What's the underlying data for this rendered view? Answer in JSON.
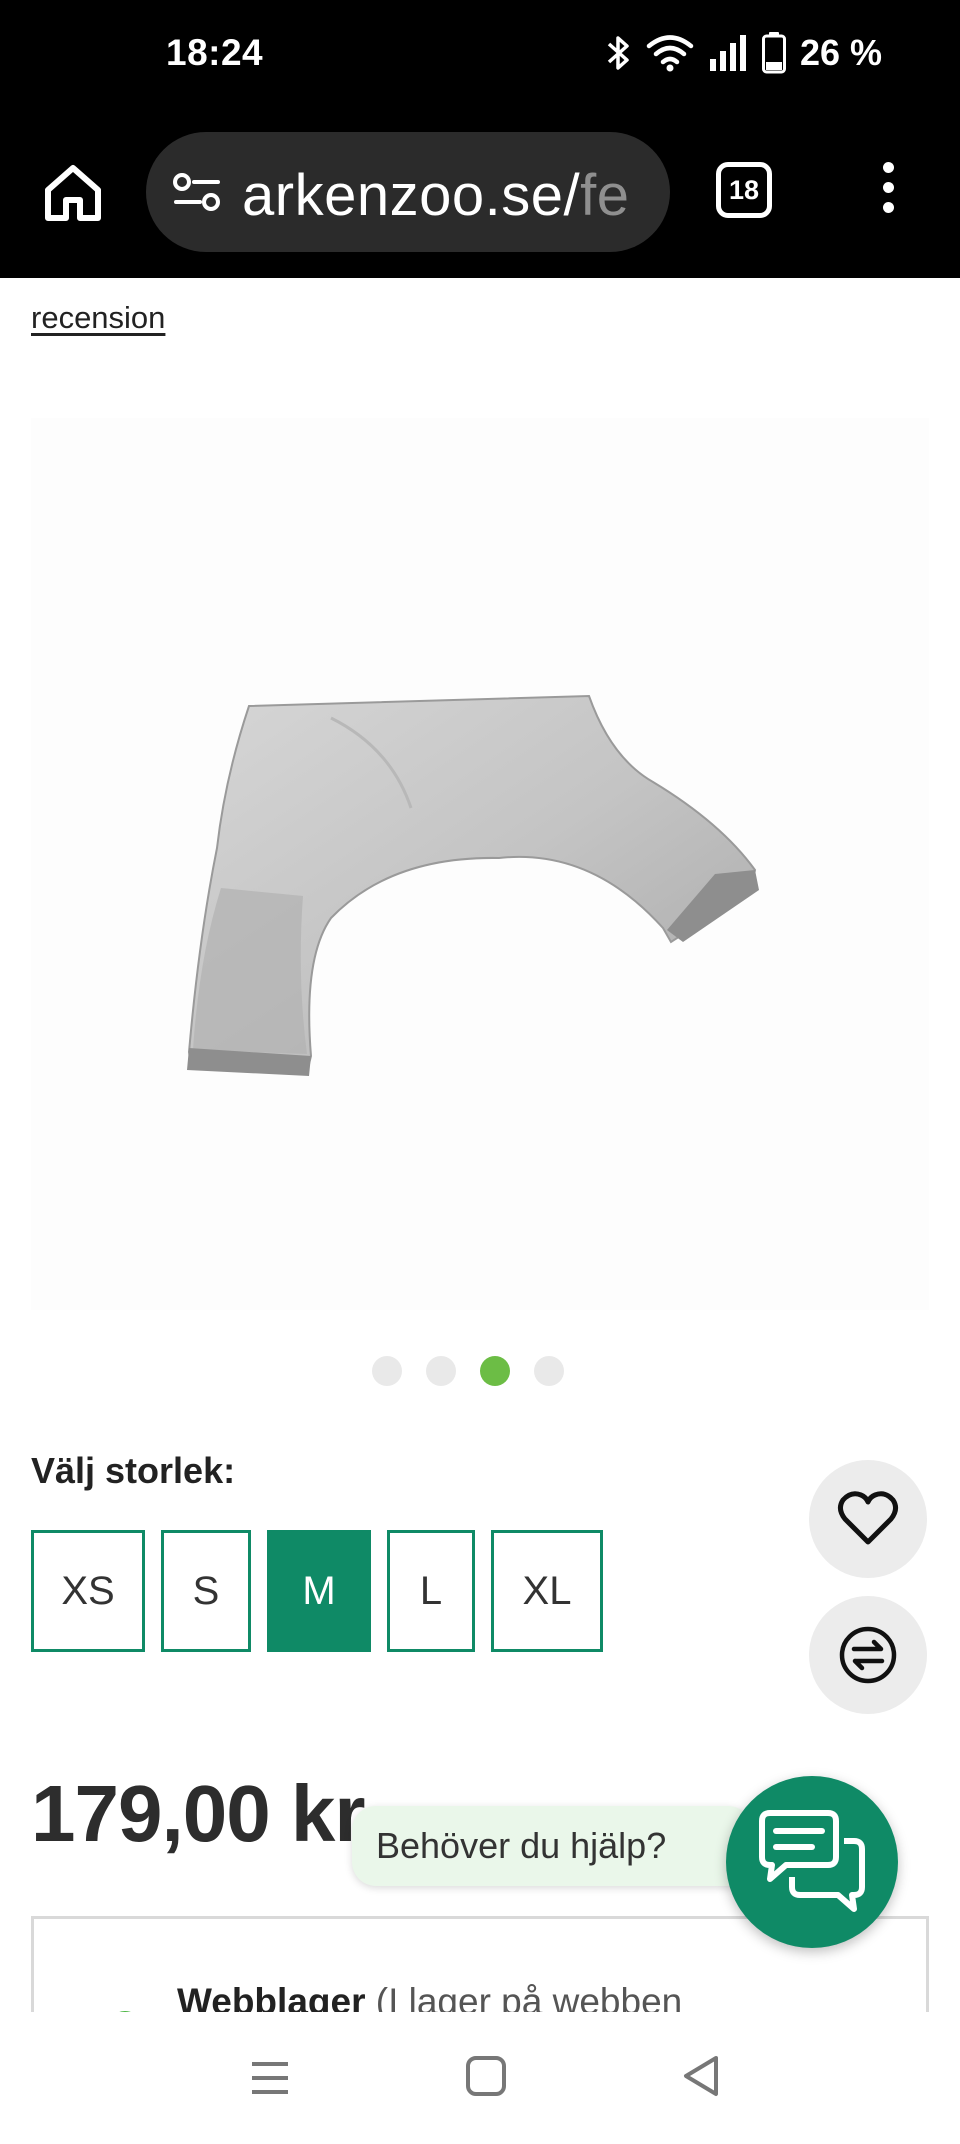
{
  "status_bar": {
    "time": "18:24",
    "battery": "26 %",
    "icons": [
      "bluetooth-icon",
      "wifi-icon",
      "signal-icon",
      "battery-icon"
    ]
  },
  "browser": {
    "url_main": "arkenzoo.se/",
    "url_faded": "fe",
    "tab_count": "18"
  },
  "product": {
    "review_link": "recension",
    "gallery": {
      "total_images": 4,
      "active_index": 2
    },
    "size_label": "Välj storlek:",
    "sizes": [
      "XS",
      "S",
      "M",
      "L",
      "XL"
    ],
    "selected_size": "M",
    "price": "179,00 kr",
    "stock": {
      "title": "Webblager",
      "detail": "(I lager på webben"
    }
  },
  "help": {
    "bubble_text": "Behöver du hjälp?"
  },
  "colors": {
    "brand": "#0f8a66",
    "active_dot": "#6cbd45",
    "in_stock": "#4bb543"
  }
}
